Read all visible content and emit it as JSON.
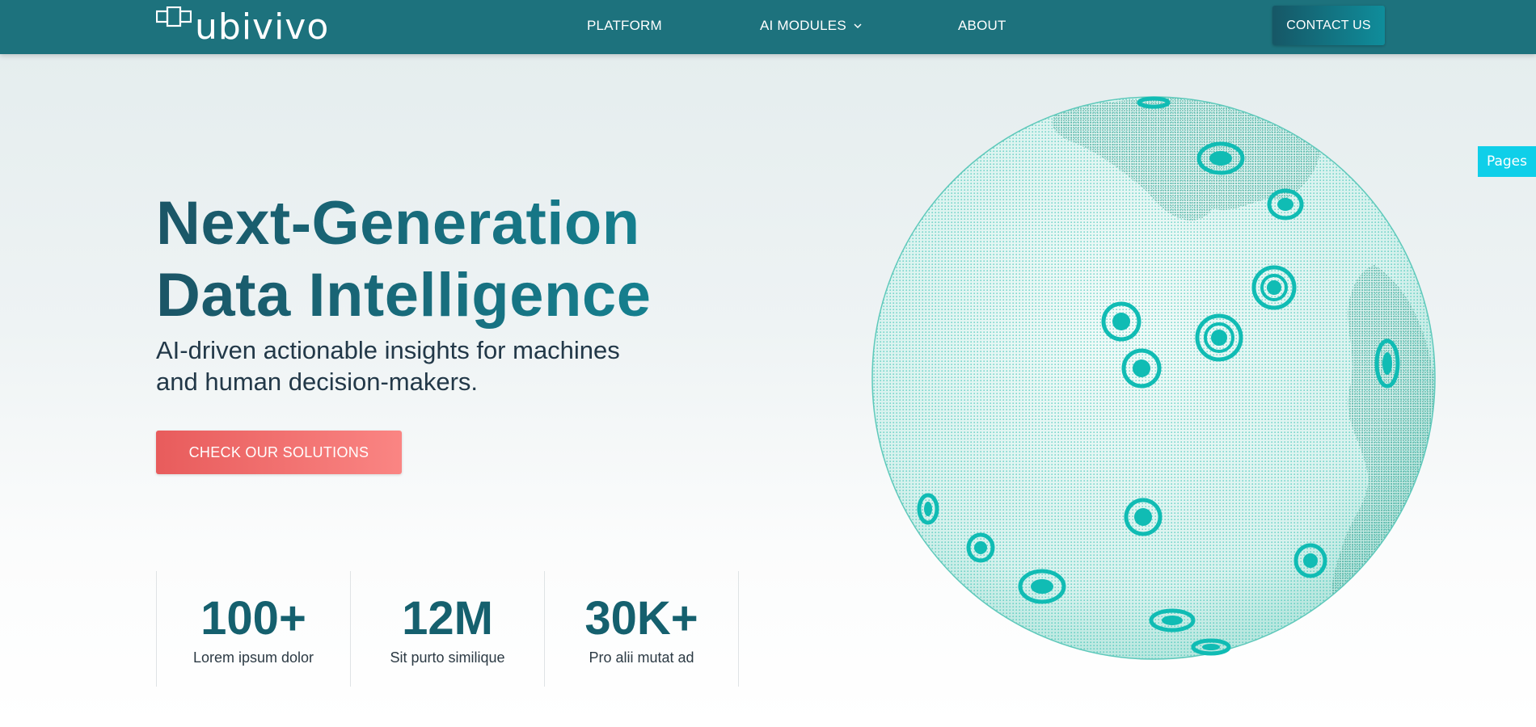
{
  "header": {
    "logo_text": "ubivivo",
    "nav": {
      "platform": "PLATFORM",
      "ai_modules": "AI MODULES",
      "about": "ABOUT"
    },
    "contact_label": "CONTACT US"
  },
  "hero": {
    "title_line1": "Next-Generation",
    "title_line2": "Data Intelligence",
    "subtitle_line1": "AI-driven actionable insights for machines",
    "subtitle_line2": "and human decision-makers.",
    "cta_label": "CHECK OUR SOLUTIONS"
  },
  "stats": [
    {
      "value": "100+",
      "label": "Lorem ipsum dolor"
    },
    {
      "value": "12M",
      "label": "Sit purto similique"
    },
    {
      "value": "30K+",
      "label": "Pro alii mutat ad"
    }
  ],
  "side_tab": {
    "label": "Pages"
  },
  "colors": {
    "header_bg": "#1d727d",
    "accent_teal": "#15808f",
    "cta_red": "#e85c5c",
    "globe_teal": "#12c2bb",
    "pages_tab": "#0fcfe9"
  },
  "icons": {
    "logo": "logo-mark-icon",
    "dropdown": "chevron-down-icon",
    "globe": "globe-illustration"
  }
}
